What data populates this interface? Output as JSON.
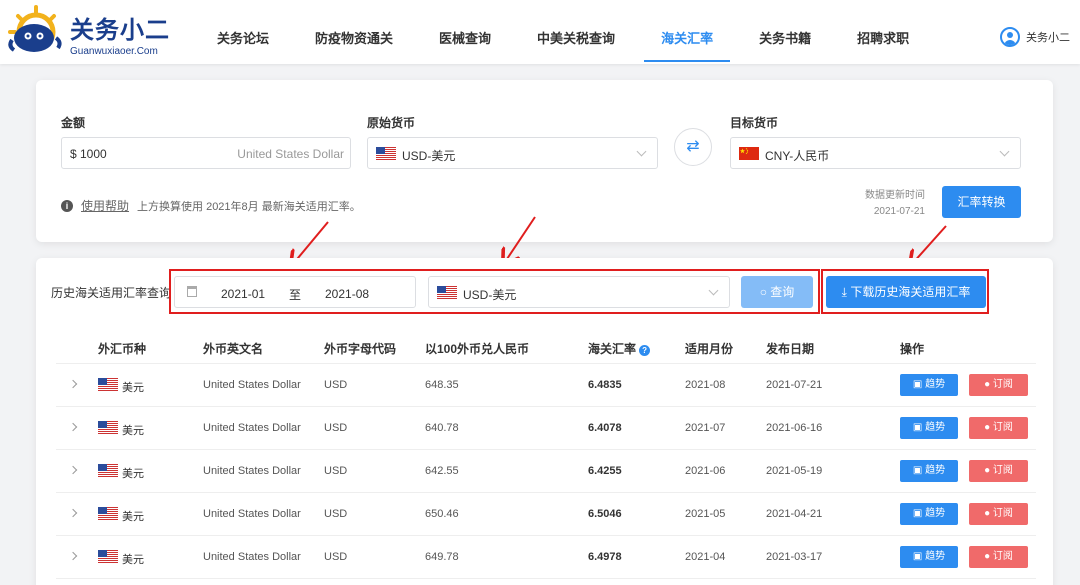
{
  "colors": {
    "primary": "#2d8cf0",
    "danger": "#f06a6a",
    "annotation_red": "#e01e1e",
    "brand": "#1a3e8c"
  },
  "brand": {
    "name": "关务小二",
    "domain": "Guanwuxiaoer.Com"
  },
  "nav": [
    {
      "label": "关务论坛",
      "active": false
    },
    {
      "label": "防疫物资通关",
      "active": false
    },
    {
      "label": "医械查询",
      "active": false
    },
    {
      "label": "中美关税查询",
      "active": false
    },
    {
      "label": "海关汇率",
      "active": true
    },
    {
      "label": "关务书籍",
      "active": false
    },
    {
      "label": "招聘求职",
      "active": false
    }
  ],
  "user": {
    "name": "关务小二"
  },
  "converter": {
    "amount_label": "金额",
    "amount_value": "$ 1000",
    "amount_unit": "United States Dollar",
    "source_label": "原始货币",
    "source_value": "USD-美元",
    "target_label": "目标货币",
    "target_value": "CNY-人民币",
    "swap_icon": "swap-icon",
    "help_link": "使用帮助",
    "help_text": "上方换算使用 2021年8月 最新海关适用汇率。",
    "update_label": "数据更新时间",
    "update_date": "2021-07-21",
    "convert_button": "汇率转换"
  },
  "history": {
    "label": "历史海关适用汇率查询",
    "date_start": "2021-01",
    "date_sep": "至",
    "date_end": "2021-08",
    "currency": "USD-美元",
    "query_button": "查询",
    "download_button": "下载历史海关适用汇率"
  },
  "table": {
    "headers": [
      "外汇币种",
      "外币英文名",
      "外币字母代码",
      "以100外币兑人民币",
      "海关汇率",
      "适用月份",
      "发布日期",
      "操作"
    ],
    "trend_label": "趋势",
    "subscribe_label": "订阅",
    "rows": [
      {
        "cname": "美元",
        "ename": "United States Dollar",
        "code": "USD",
        "per100": "648.35",
        "rate": "6.4835",
        "month": "2021-08",
        "date": "2021-07-21"
      },
      {
        "cname": "美元",
        "ename": "United States Dollar",
        "code": "USD",
        "per100": "640.78",
        "rate": "6.4078",
        "month": "2021-07",
        "date": "2021-06-16"
      },
      {
        "cname": "美元",
        "ename": "United States Dollar",
        "code": "USD",
        "per100": "642.55",
        "rate": "6.4255",
        "month": "2021-06",
        "date": "2021-05-19"
      },
      {
        "cname": "美元",
        "ename": "United States Dollar",
        "code": "USD",
        "per100": "650.46",
        "rate": "6.5046",
        "month": "2021-05",
        "date": "2021-04-21"
      },
      {
        "cname": "美元",
        "ename": "United States Dollar",
        "code": "USD",
        "per100": "649.78",
        "rate": "6.4978",
        "month": "2021-04",
        "date": "2021-03-17"
      }
    ]
  }
}
